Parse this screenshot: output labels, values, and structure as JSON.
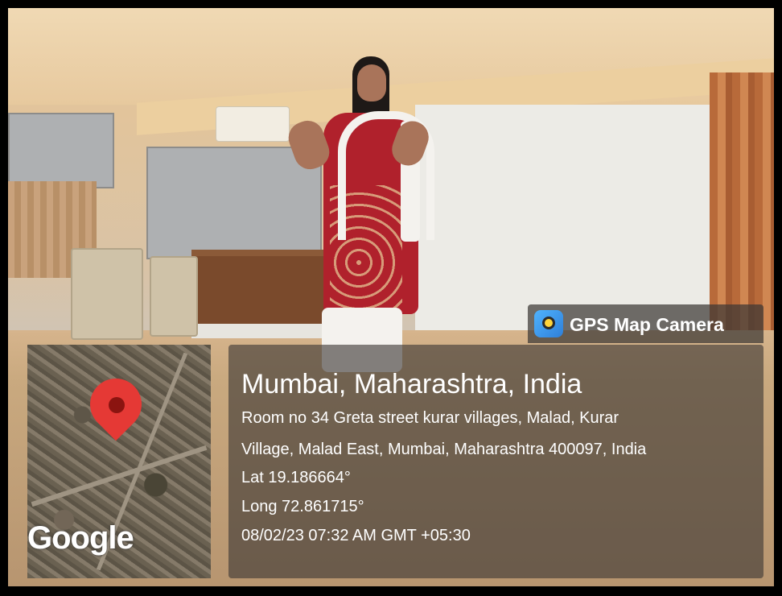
{
  "camera_tag": {
    "label": "GPS Map Camera",
    "icon": "gps-map-camera-app-icon"
  },
  "map": {
    "brand": "Google",
    "pin_color": "#e53935"
  },
  "location": {
    "title": "Mumbai, Maharashtra, India",
    "address_line1": "Room no 34 Greta street kurar villages, Malad, Kurar",
    "address_line2": "Village, Malad East, Mumbai, Maharashtra 400097, India",
    "lat": "Lat 19.186664°",
    "long": "Long 72.861715°",
    "timestamp": "08/02/23 07:32 AM GMT +05:30"
  },
  "colors": {
    "overlay": "#3c3734",
    "text": "#ffffff",
    "frame": "#000000"
  }
}
